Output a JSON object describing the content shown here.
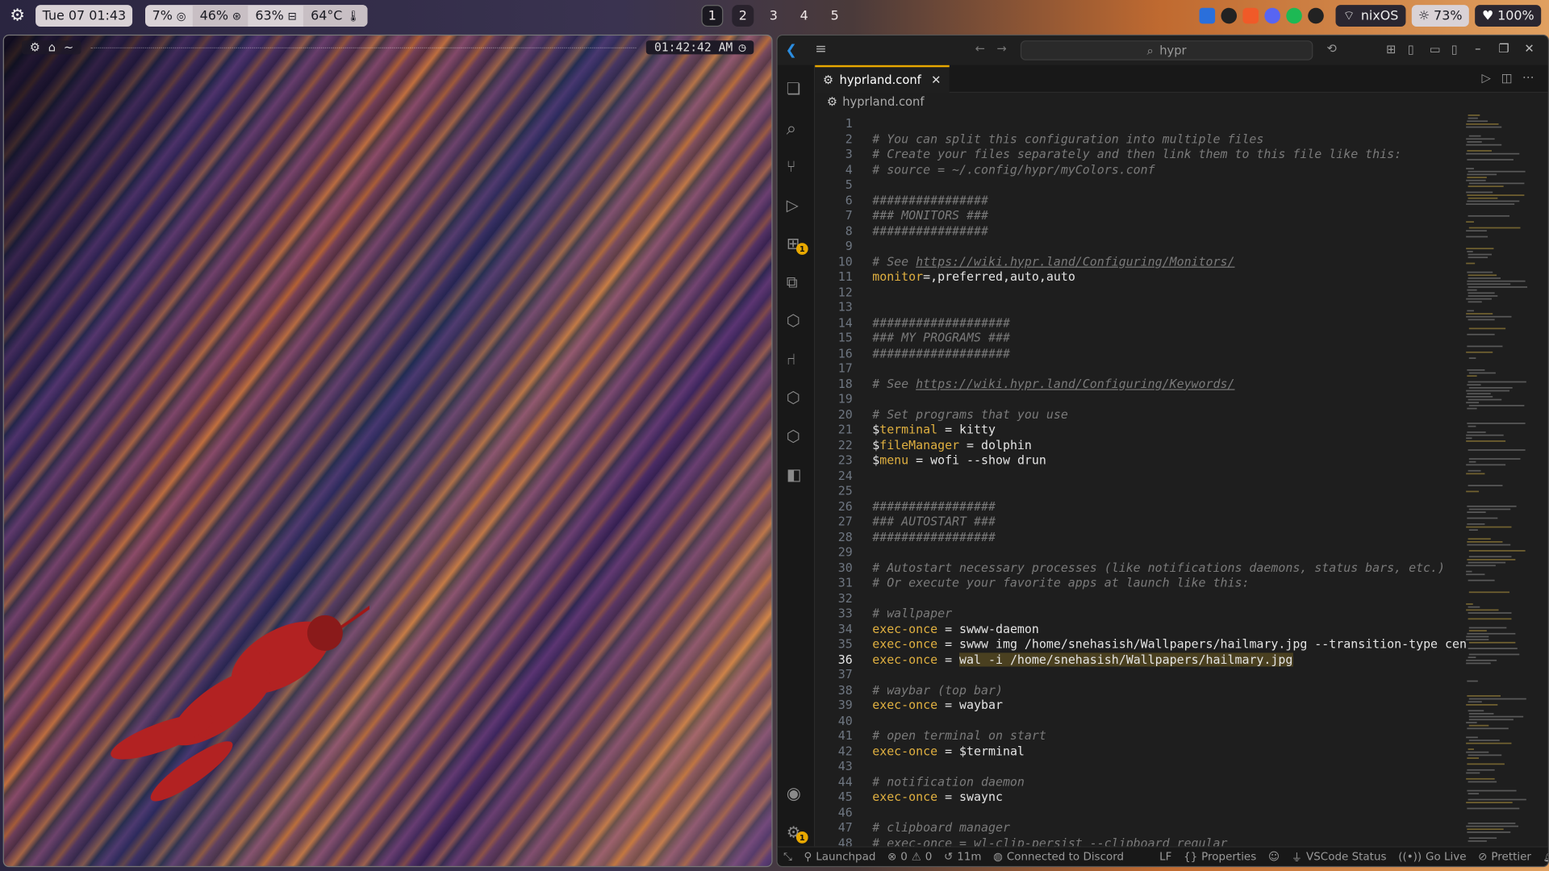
{
  "topbar": {
    "date_time": "Tue 07 01:43",
    "cpu": "7%",
    "memory": "46%",
    "disk": "63%",
    "temp": "64°C",
    "workspaces": [
      "1",
      "2",
      "3",
      "4",
      "5"
    ],
    "host": "nixOS",
    "brightness": "73%",
    "battery": "100%",
    "icons": [
      "settings-icon",
      "cpu-icon",
      "memory-icon",
      "disk-icon",
      "thermometer-icon",
      "vscode-tray-icon",
      "tray-app-icon",
      "brave-icon",
      "discord-icon",
      "spotify-icon",
      "tray-app-icon-2",
      "wifi-icon",
      "brightness-icon",
      "heart-icon"
    ]
  },
  "wallpaper_window": {
    "path_label": "~",
    "clock": "01:42:42 AM"
  },
  "vscode": {
    "search_text": "hypr",
    "tab_label": "hyprland.conf",
    "breadcrumb": "hyprland.conf",
    "current_line": "36",
    "lines": [
      {
        "n": "1",
        "t": []
      },
      {
        "n": "2",
        "t": [
          [
            "com",
            "# You can split this configuration into multiple files"
          ]
        ]
      },
      {
        "n": "3",
        "t": [
          [
            "com",
            "# Create your files separately and then link them to this file like this:"
          ]
        ]
      },
      {
        "n": "4",
        "t": [
          [
            "com",
            "# source = ~/.config/hypr/myColors.conf"
          ]
        ]
      },
      {
        "n": "5",
        "t": []
      },
      {
        "n": "6",
        "t": [
          [
            "com",
            "################"
          ]
        ]
      },
      {
        "n": "7",
        "t": [
          [
            "com",
            "### MONITORS ###"
          ]
        ]
      },
      {
        "n": "8",
        "t": [
          [
            "com",
            "################"
          ]
        ]
      },
      {
        "n": "9",
        "t": []
      },
      {
        "n": "10",
        "t": [
          [
            "com",
            "# See "
          ],
          [
            "link",
            "https://wiki.hypr.land/Configuring/Monitors/"
          ]
        ]
      },
      {
        "n": "11",
        "t": [
          [
            "kw",
            "monitor"
          ],
          [
            "txt",
            "=,preferred,auto,auto"
          ]
        ]
      },
      {
        "n": "12",
        "t": []
      },
      {
        "n": "13",
        "t": []
      },
      {
        "n": "14",
        "t": [
          [
            "com",
            "###################"
          ]
        ]
      },
      {
        "n": "15",
        "t": [
          [
            "com",
            "### MY PROGRAMS ###"
          ]
        ]
      },
      {
        "n": "16",
        "t": [
          [
            "com",
            "###################"
          ]
        ]
      },
      {
        "n": "17",
        "t": []
      },
      {
        "n": "18",
        "t": [
          [
            "com",
            "# See "
          ],
          [
            "link",
            "https://wiki.hypr.land/Configuring/Keywords/"
          ]
        ]
      },
      {
        "n": "19",
        "t": []
      },
      {
        "n": "20",
        "t": [
          [
            "com",
            "# Set programs that you use"
          ]
        ]
      },
      {
        "n": "21",
        "t": [
          [
            "txt",
            "$"
          ],
          [
            "var",
            "terminal"
          ],
          [
            "txt",
            " = kitty"
          ]
        ]
      },
      {
        "n": "22",
        "t": [
          [
            "txt",
            "$"
          ],
          [
            "var",
            "fileManager"
          ],
          [
            "txt",
            " = dolphin"
          ]
        ]
      },
      {
        "n": "23",
        "t": [
          [
            "txt",
            "$"
          ],
          [
            "var",
            "menu"
          ],
          [
            "txt",
            " = wofi --show drun"
          ]
        ]
      },
      {
        "n": "24",
        "t": []
      },
      {
        "n": "25",
        "t": []
      },
      {
        "n": "26",
        "t": [
          [
            "com",
            "#################"
          ]
        ]
      },
      {
        "n": "27",
        "t": [
          [
            "com",
            "### AUTOSTART ###"
          ]
        ]
      },
      {
        "n": "28",
        "t": [
          [
            "com",
            "#################"
          ]
        ]
      },
      {
        "n": "29",
        "t": []
      },
      {
        "n": "30",
        "t": [
          [
            "com",
            "# Autostart necessary processes (like notifications daemons, status bars, etc.)"
          ]
        ]
      },
      {
        "n": "31",
        "t": [
          [
            "com",
            "# Or execute your favorite apps at launch like this:"
          ]
        ]
      },
      {
        "n": "32",
        "t": []
      },
      {
        "n": "33",
        "t": [
          [
            "com",
            "# wallpaper"
          ]
        ]
      },
      {
        "n": "34",
        "t": [
          [
            "kw",
            "exec-once"
          ],
          [
            "txt",
            " = swww-daemon"
          ]
        ]
      },
      {
        "n": "35",
        "t": [
          [
            "kw",
            "exec-once"
          ],
          [
            "txt",
            " = swww img /home/snehasish/Wallpapers/hailmary.jpg --transition-type center"
          ]
        ]
      },
      {
        "n": "36",
        "t": [
          [
            "kw",
            "exec-once"
          ],
          [
            "txt",
            " = "
          ],
          [
            "hl",
            "wal -i /home/snehasish/Wallpapers/hailmary.jpg"
          ]
        ]
      },
      {
        "n": "37",
        "t": []
      },
      {
        "n": "38",
        "t": [
          [
            "com",
            "# waybar (top bar)"
          ]
        ]
      },
      {
        "n": "39",
        "t": [
          [
            "kw",
            "exec-once"
          ],
          [
            "txt",
            " = waybar"
          ]
        ]
      },
      {
        "n": "40",
        "t": []
      },
      {
        "n": "41",
        "t": [
          [
            "com",
            "# open terminal on start"
          ]
        ]
      },
      {
        "n": "42",
        "t": [
          [
            "kw",
            "exec-once"
          ],
          [
            "txt",
            " = $terminal"
          ]
        ]
      },
      {
        "n": "43",
        "t": []
      },
      {
        "n": "44",
        "t": [
          [
            "com",
            "# notification daemon"
          ]
        ]
      },
      {
        "n": "45",
        "t": [
          [
            "kw",
            "exec-once"
          ],
          [
            "txt",
            " = swaync"
          ]
        ]
      },
      {
        "n": "46",
        "t": []
      },
      {
        "n": "47",
        "t": [
          [
            "com",
            "# clipboard manager"
          ]
        ]
      },
      {
        "n": "48",
        "t": [
          [
            "com",
            "# exec-once = wl-clip-persist --clipboard regular"
          ]
        ]
      }
    ],
    "status": {
      "launchpad": "Launchpad",
      "errors": "0",
      "warnings": "0",
      "time": "11m",
      "discord": "Connected to Discord",
      "eol": "LF",
      "properties": "Properties",
      "vscode_status": "VSCode Status",
      "go_live": "Go Live",
      "prettier": "Prettier"
    },
    "badges": {
      "extensions": "1",
      "settings": "1"
    },
    "accent": "#e8a800"
  }
}
